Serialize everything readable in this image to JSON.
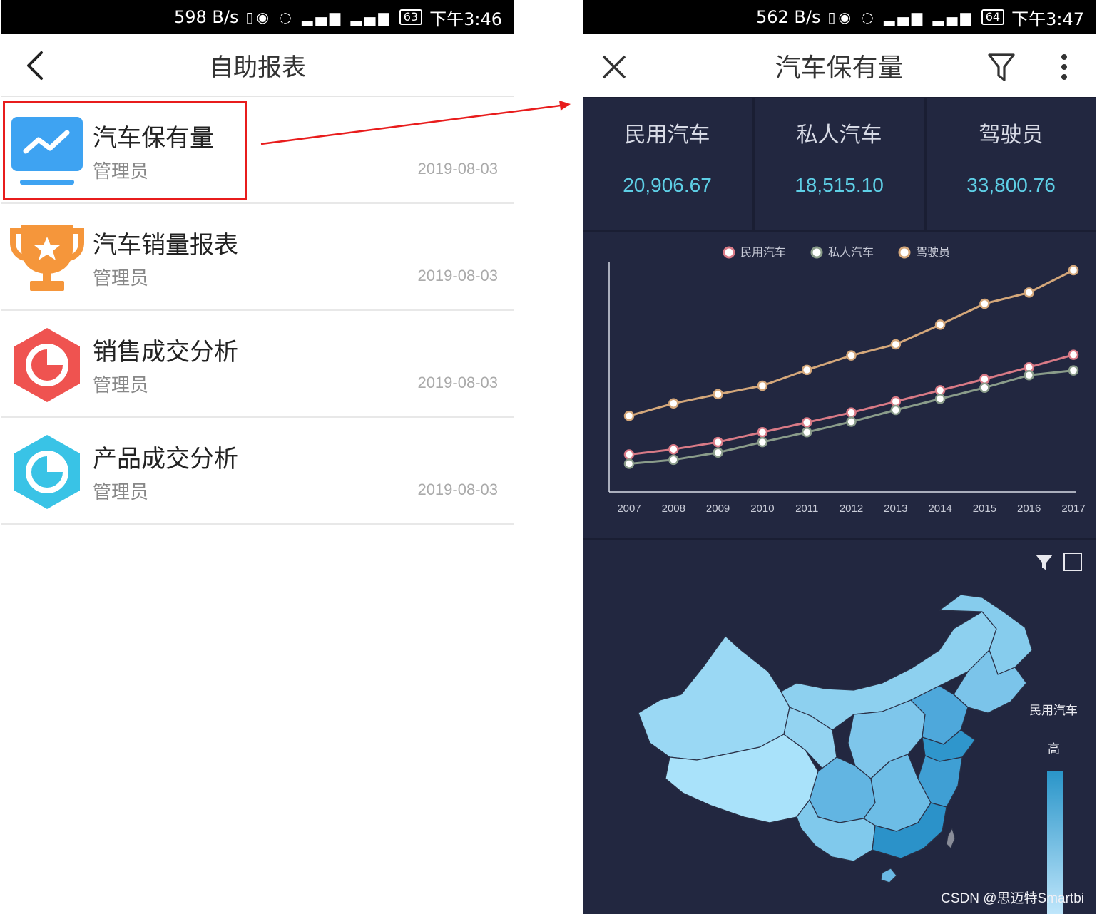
{
  "left": {
    "status": {
      "speed": "598 B/s",
      "battery": "63",
      "time": "下午3:46"
    },
    "nav": {
      "title": "自助报表",
      "back_icon": "chevron-left-icon"
    },
    "reports": [
      {
        "name": "汽车保有量",
        "owner": "管理员",
        "date": "2019-08-03",
        "icon": "trend-monitor-icon",
        "color": "#3ea3f2"
      },
      {
        "name": "汽车销量报表",
        "owner": "管理员",
        "date": "2019-08-03",
        "icon": "trophy-icon",
        "color": "#f5963b"
      },
      {
        "name": "销售成交分析",
        "owner": "管理员",
        "date": "2019-08-03",
        "icon": "pie-hexagon-icon",
        "color": "#ef5350"
      },
      {
        "name": "产品成交分析",
        "owner": "管理员",
        "date": "2019-08-03",
        "icon": "pie-hexagon-icon",
        "color": "#39c3e6"
      }
    ]
  },
  "right": {
    "status": {
      "speed": "562 B/s",
      "battery": "64",
      "time": "下午3:47"
    },
    "nav": {
      "title": "汽车保有量"
    },
    "kpis": [
      {
        "label": "民用汽车",
        "value": "20,906.67"
      },
      {
        "label": "私人汽车",
        "value": "18,515.10"
      },
      {
        "label": "驾驶员",
        "value": "33,800.76"
      }
    ],
    "map": {
      "legend_title": "民用汽车",
      "legend_high": "高",
      "low_color": "#bfe6fb",
      "high_color": "#2a95c9"
    }
  },
  "watermark": "CSDN @思迈特Smartbi",
  "colors": {
    "accent_red": "#e81c1c",
    "panel_bg": "#222740",
    "kpi_value": "#5ecfe6"
  },
  "chart_data": {
    "type": "line",
    "categories": [
      "2007",
      "2008",
      "2009",
      "2010",
      "2011",
      "2012",
      "2013",
      "2014",
      "2015",
      "2016",
      "2017"
    ],
    "legend_position": "top",
    "grid": false,
    "ylim": [
      0,
      35000
    ],
    "series": [
      {
        "name": "民用汽车",
        "color": "#d97a86",
        "values": [
          5700,
          6500,
          7600,
          9100,
          10600,
          12100,
          13800,
          15500,
          17200,
          19000,
          20906.67
        ]
      },
      {
        "name": "私人汽车",
        "color": "#8a9c8a",
        "values": [
          4300,
          4900,
          6000,
          7600,
          9100,
          10700,
          12500,
          14200,
          15900,
          17800,
          18515.1
        ]
      },
      {
        "name": "驾驶员",
        "color": "#d4a77a",
        "values": [
          11600,
          13500,
          14900,
          16200,
          18600,
          20800,
          22500,
          25500,
          28700,
          30400,
          33800.76
        ]
      }
    ]
  }
}
